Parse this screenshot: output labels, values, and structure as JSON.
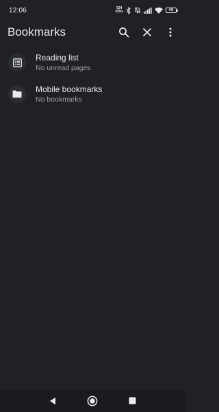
{
  "status_bar": {
    "time": "12:06",
    "net_speed_value": "534",
    "net_speed_unit": "KB/s",
    "battery": "46",
    "icons": [
      "bluetooth-icon",
      "do-not-disturb-icon",
      "signal-icon",
      "wifi-icon",
      "battery-icon"
    ]
  },
  "app_bar": {
    "title": "Bookmarks",
    "actions": [
      "search-icon",
      "close-icon",
      "more-vert-icon"
    ]
  },
  "bookmarks": {
    "items": [
      {
        "title": "Reading list",
        "subtitle": "No unread pages",
        "icon": "reading-list-icon"
      },
      {
        "title": "Mobile bookmarks",
        "subtitle": "No bookmarks",
        "icon": "folder-icon"
      }
    ]
  },
  "nav_bar": {
    "buttons": [
      "back-icon",
      "home-icon",
      "recents-icon"
    ]
  },
  "colors": {
    "background": "#1f2124",
    "text_primary": "#e8eaed",
    "text_secondary": "#9aa0a6",
    "icon_circle": "#2a2d31"
  }
}
